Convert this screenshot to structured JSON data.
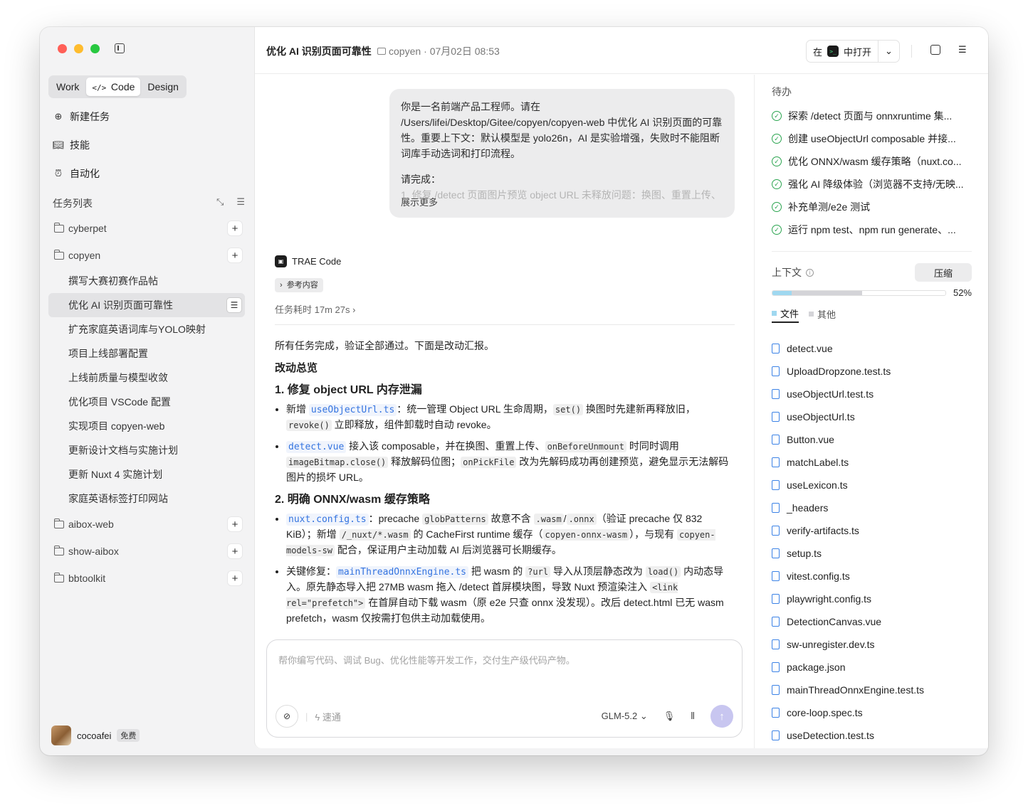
{
  "sidebar": {
    "mode_tabs": [
      "Work",
      "Code",
      "Design"
    ],
    "nav": [
      {
        "icon": "plus-circle-icon",
        "label": "新建任务"
      },
      {
        "icon": "book-icon",
        "label": "技能"
      },
      {
        "icon": "alarm-clock-icon",
        "label": "自动化"
      }
    ],
    "task_list_title": "任务列表",
    "folders": [
      {
        "name": "cyberpet",
        "tasks": []
      },
      {
        "name": "copyen",
        "tasks": [
          "撰写大赛初赛作品帖",
          "优化 AI 识别页面可靠性",
          "扩充家庭英语词库与YOLO映射",
          "项目上线部署配置",
          "上线前质量与模型收敛",
          "优化项目 VSCode 配置",
          "实现项目 copyen-web",
          "更新设计文档与实施计划",
          "更新 Nuxt 4 实施计划",
          "家庭英语标签打印网站"
        ]
      },
      {
        "name": "aibox-web",
        "tasks": []
      },
      {
        "name": "show-aibox",
        "tasks": []
      },
      {
        "name": "bbtoolkit",
        "tasks": []
      }
    ],
    "user": {
      "name": "cocoafei",
      "plan": "免费"
    }
  },
  "header": {
    "title": "优化 AI 识别页面可靠性",
    "project": "copyen",
    "timestamp": "· 07月02日 08:53",
    "open_in_prefix": "在",
    "open_in_suffix": "中打开"
  },
  "user_message": {
    "text": "你是一名前端产品工程师。请在 /Users/lifei/Desktop/Gitee/copyen/copyen-web 中优化 AI 识别页面的可靠性。重要上下文：默认模型是 yolo26n，AI 是实验增强，失败时不能阻断词库手动选词和打印流程。",
    "line2": "请完成：",
    "line3": "1. 修复 /detect 页面图片预览 object URL 未释放问题：换图、重置上传、",
    "show_more": "展示更多"
  },
  "agent": {
    "name": "TRAE Code",
    "ref_chip": "参考内容",
    "duration": "任务耗时 17m 27s",
    "intro": "所有任务完成，验证全部通过。下面是改动汇报。",
    "overview": "改动总览",
    "s1_title": "1. 修复 object URL 内存泄漏",
    "s2_title": "2. 明确 ONNX/wasm 缓存策略"
  },
  "composer": {
    "placeholder": "帮你编写代码、调试 Bug、优化性能等开发工作，交付生产级代码产物。",
    "speed_label": "速通",
    "model": "GLM-5.2"
  },
  "right_panel": {
    "todo_title": "待办",
    "todos": [
      "探索 /detect 页面与 onnxruntime 集...",
      "创建 useObjectUrl composable 并接...",
      "优化 ONNX/wasm 缓存策略（nuxt.co...",
      "强化 AI 降级体验（浏览器不支持/无映...",
      "补充单测/e2e 测试",
      "运行 npm test、npm run generate、..."
    ],
    "context_label": "上下文",
    "compress_label": "压缩",
    "context_percent": "52%",
    "context_fill": {
      "files": 0.11,
      "other": 0.41
    },
    "tab_files": "文件",
    "tab_other": "其他",
    "files": [
      "detect.vue",
      "UploadDropzone.test.ts",
      "useObjectUrl.test.ts",
      "useObjectUrl.ts",
      "Button.vue",
      "matchLabel.ts",
      "useLexicon.ts",
      "_headers",
      "verify-artifacts.ts",
      "setup.ts",
      "vitest.config.ts",
      "playwright.config.ts",
      "DetectionCanvas.vue",
      "sw-unregister.dev.ts",
      "package.json",
      "mainThreadOnnxEngine.test.ts",
      "core-loop.spec.ts",
      "useDetection.test.ts"
    ]
  },
  "colors": {
    "traffic_red": "#ff5f57",
    "traffic_yellow": "#febc2e",
    "traffic_green": "#28c840",
    "accent_link": "#3474e0",
    "check_green": "#2aa44f",
    "send_bg": "#c8c6f0"
  }
}
